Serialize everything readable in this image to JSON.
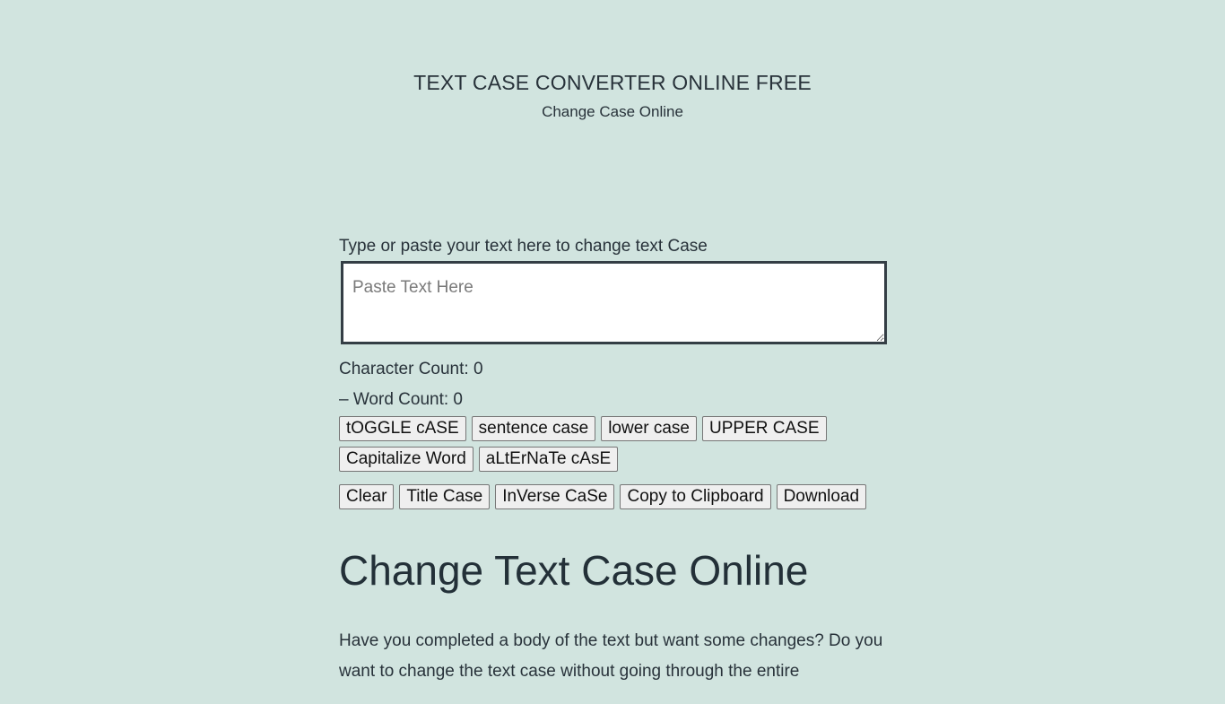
{
  "header": {
    "title": "TEXT CASE CONVERTER ONLINE FREE",
    "tagline": "Change Case Online"
  },
  "editor": {
    "label": "Type or paste your text here to change text Case",
    "placeholder": "Paste Text Here",
    "value": ""
  },
  "stats": {
    "character_count": "Character Count: 0",
    "word_count": "– Word Count: 0"
  },
  "buttons": {
    "row1": [
      "tOGGLE cASE",
      "sentence case",
      "lower case",
      "UPPER CASE"
    ],
    "row2": [
      "Capitalize Word",
      "aLtErNaTe cAsE"
    ],
    "row3": [
      "Clear",
      "Title Case",
      "InVerse CaSe",
      "Copy to Clipboard",
      "Download"
    ]
  },
  "content": {
    "heading": "Change Text Case Online",
    "paragraph": "Have you completed a body of the text but want some changes? Do you want to change the text case without going through the entire"
  },
  "colors": {
    "background": "#d1e4df",
    "text": "#28323a",
    "textarea_border": "#343e45"
  }
}
